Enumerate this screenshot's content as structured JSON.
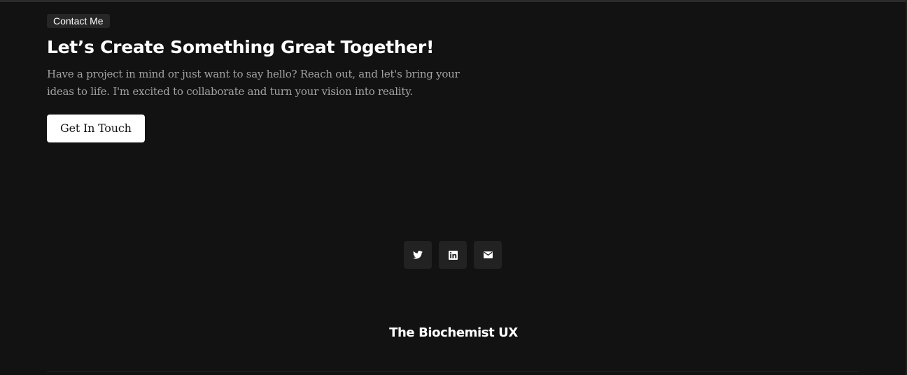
{
  "contact": {
    "badge": "Contact Me",
    "heading": "Let’s Create Something Great Together!",
    "description": "Have a project in mind or just want to say hello? Reach out, and let's bring your ideas to life. I'm excited to collaborate and turn your vision into reality.",
    "cta_label": "Get In Touch"
  },
  "social": {
    "items": [
      {
        "icon": "twitter-icon"
      },
      {
        "icon": "linkedin-icon"
      },
      {
        "icon": "mail-icon"
      }
    ]
  },
  "footer": {
    "brand": "The Biochemist UX"
  },
  "colors": {
    "background": "#121212",
    "button_bg": "#ffffff",
    "icon_button_bg": "#222222",
    "muted_text": "#a3a3a3"
  }
}
